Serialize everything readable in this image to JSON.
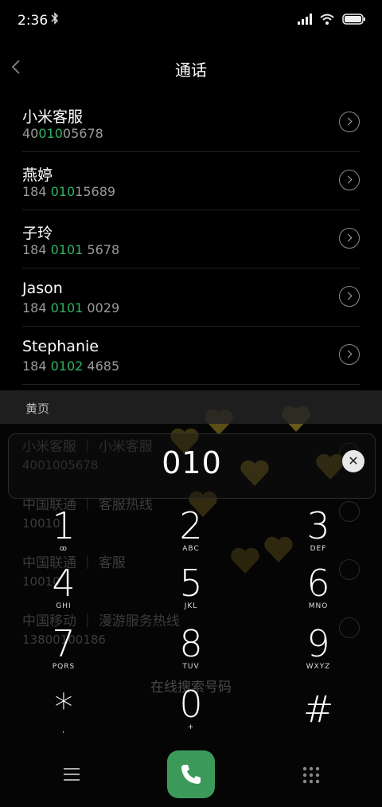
{
  "status": {
    "time": "2:36"
  },
  "header": {
    "title": "通话"
  },
  "contacts": [
    {
      "name": "小米客服",
      "pre": "40",
      "hl": "010",
      "post": "05678"
    },
    {
      "name": "燕婷",
      "pre": "184 ",
      "hl": "010",
      "post": "15689"
    },
    {
      "name": "子玲",
      "pre": "184 ",
      "hl": "0101",
      "post": " 5678"
    },
    {
      "name": "Jason",
      "pre": "184 ",
      "hl": "0101",
      "post": " 0029"
    },
    {
      "name": "Stephanie",
      "pre": "184 ",
      "hl": "0102",
      "post": " 4685"
    }
  ],
  "yellow_pages": {
    "label": "黄页",
    "items": [
      {
        "name": "小米客服",
        "tag": "小米客服",
        "number": "4001005678"
      },
      {
        "name": "中国联通",
        "tag": "客服热线",
        "number": "10010"
      },
      {
        "name": "中国联通",
        "tag": "客服",
        "number": "10010"
      },
      {
        "name": "中国移动",
        "tag": "漫游服务热线",
        "number": "13800100186"
      }
    ]
  },
  "dialer": {
    "input": "010",
    "search_label": "在线搜索号码",
    "keys": [
      {
        "digit": "1",
        "letters": "ꝏ"
      },
      {
        "digit": "2",
        "letters": "ABC"
      },
      {
        "digit": "3",
        "letters": "DEF"
      },
      {
        "digit": "4",
        "letters": "GHI"
      },
      {
        "digit": "5",
        "letters": "JKL"
      },
      {
        "digit": "6",
        "letters": "MNO"
      },
      {
        "digit": "7",
        "letters": "PQRS"
      },
      {
        "digit": "8",
        "letters": "TUV"
      },
      {
        "digit": "9",
        "letters": "WXYZ"
      },
      {
        "digit": "*",
        "letters": ","
      },
      {
        "digit": "0",
        "letters": "+"
      },
      {
        "digit": "#",
        "letters": ""
      }
    ]
  },
  "colors": {
    "accent": "#2eb462",
    "call_button": "#3b9a5a"
  },
  "icons": [
    "back-icon",
    "bluetooth-icon",
    "signal-icon",
    "wifi-icon",
    "battery-icon",
    "chevron-right-icon",
    "clear-icon",
    "menu-icon",
    "phone-icon",
    "dialpad-icon"
  ]
}
